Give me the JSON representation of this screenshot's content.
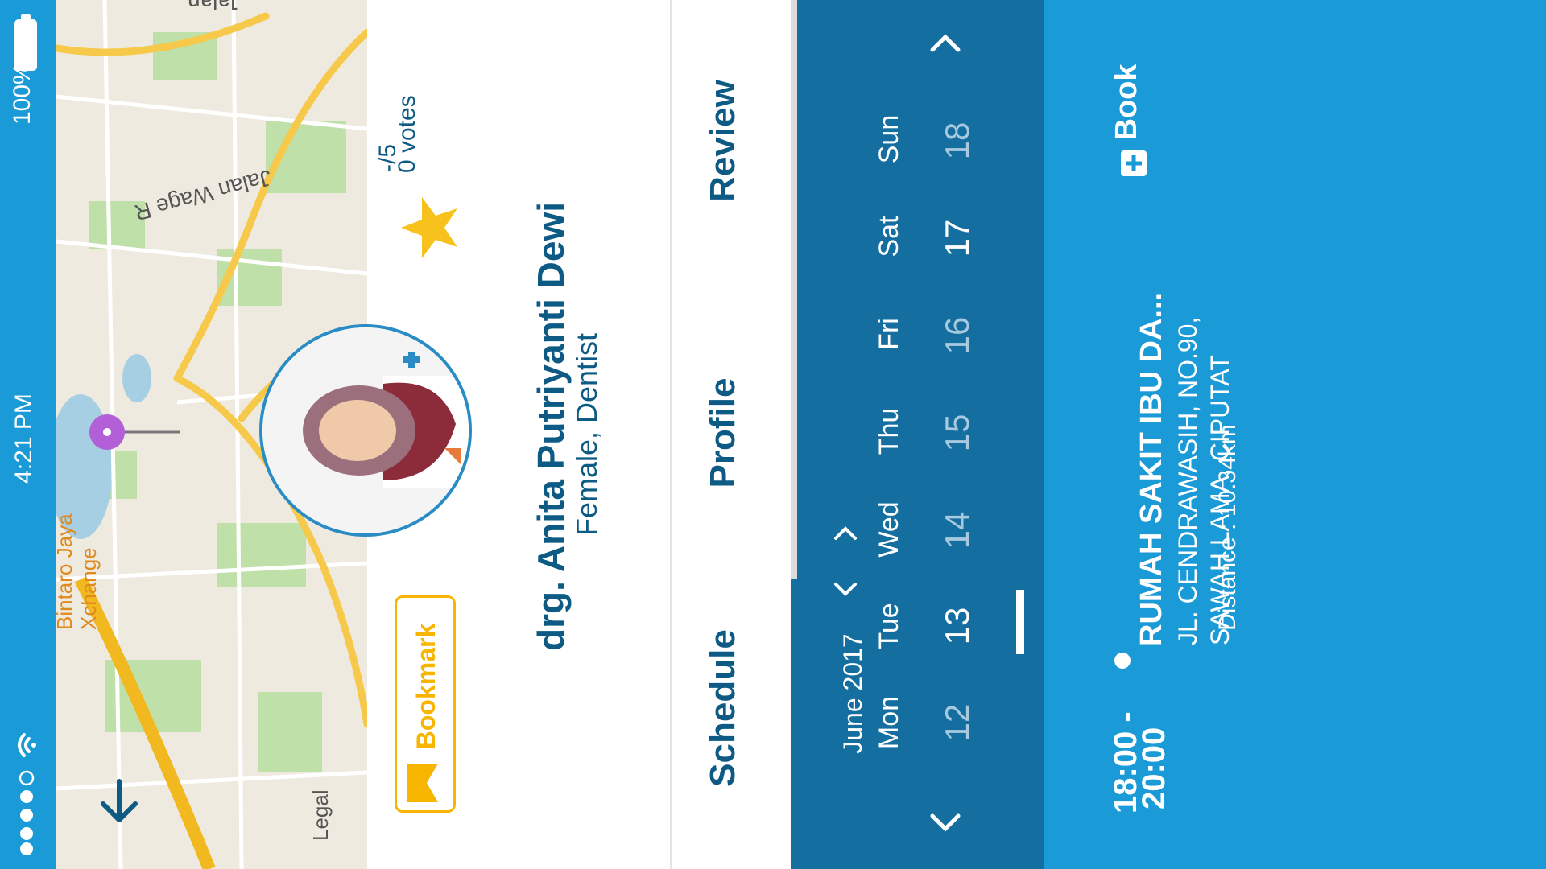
{
  "status_bar": {
    "battery": "100%",
    "time": "4:21 PM",
    "signal_icon": "signal-dots-icon",
    "wifi_icon": "wifi-icon",
    "battery_icon": "battery-icon"
  },
  "map": {
    "labels": {
      "road_top": "Jalan",
      "road_wage": "Jalan Wage R",
      "bintaro": "Bintaro Jaya",
      "xchange": "Xchange",
      "legal": "Legal"
    },
    "collapse_icon": "arrow-down-icon",
    "marker_icon": "location-pin-icon"
  },
  "doctor": {
    "name": "drg. Anita Putriyanti Dewi",
    "subtitle": "Female, Dentist",
    "rating": "-/5",
    "votes": "0 votes",
    "bookmark_label": "Bookmark",
    "star_icon": "star-icon",
    "bookmark_icon": "bookmark-icon"
  },
  "tabs": [
    {
      "label": "Review"
    },
    {
      "label": "Profile"
    },
    {
      "label": "Schedule"
    }
  ],
  "calendar": {
    "month": "June 2017",
    "days": [
      {
        "name": "Mon",
        "num": "12"
      },
      {
        "name": "Tue",
        "num": "13"
      },
      {
        "name": "Wed",
        "num": "14"
      },
      {
        "name": "Thu",
        "num": "15"
      },
      {
        "name": "Fri",
        "num": "16"
      },
      {
        "name": "Sat",
        "num": "17"
      },
      {
        "name": "Sun",
        "num": "18"
      }
    ],
    "today": "17",
    "selected": "13"
  },
  "schedule": {
    "time_start": "18:00 -",
    "time_end": "20:00",
    "hospital": "RUMAH SAKIT IBU DA...",
    "address_line1": "JL. CENDRAWASIH, NO.90,",
    "address_line2": "SAWAH LAMA, CIPUTAT",
    "distance": "Distance : 10.34km",
    "book_label": "Book"
  },
  "colors": {
    "primary": "#1a9ad6",
    "dark": "#156ea0",
    "title": "#0d5b85",
    "bookmark": "#f7b500"
  }
}
